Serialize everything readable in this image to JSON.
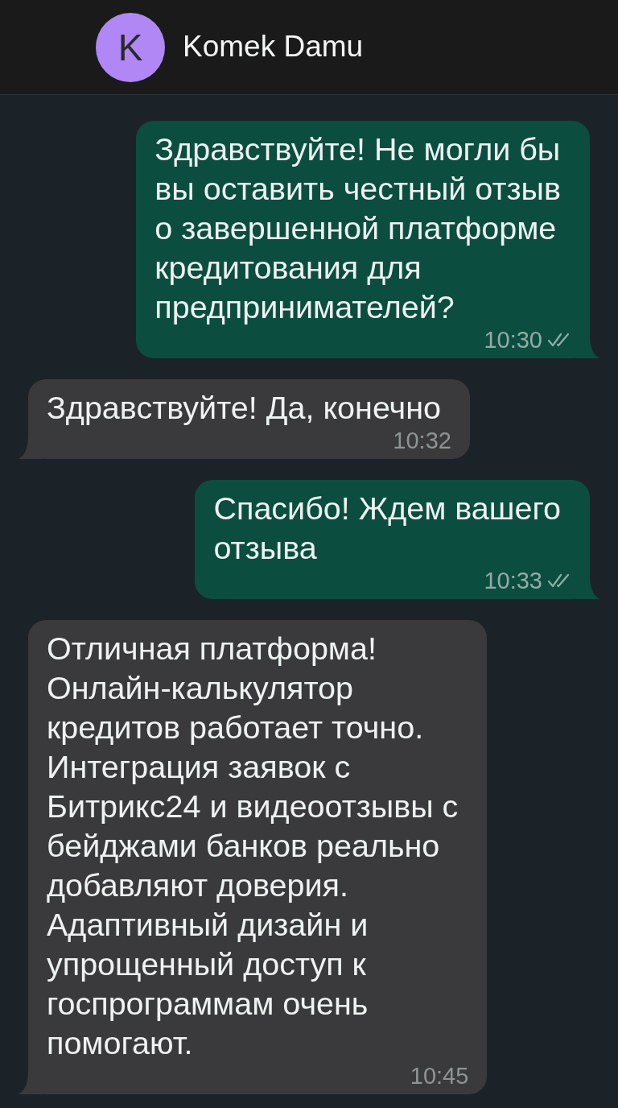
{
  "header": {
    "avatar_letter": "K",
    "name": "Komek Damu"
  },
  "messages": [
    {
      "kind": "outgoing",
      "text": "Здравствуйте! Не могли бы\nвы оставить честный отзыв\nо завершенной платформе\nкредитования для\nпредпринимателей?",
      "time": "10:30",
      "read": true
    },
    {
      "kind": "incoming",
      "text": "Здравствуйте! Да, конечно",
      "time": "10:32"
    },
    {
      "kind": "outgoing",
      "text": "Спасибо! Ждем вашего\nотзыва",
      "time": "10:33",
      "read": true
    },
    {
      "kind": "incoming",
      "text": "Отличная платформа!\nОнлайн-калькулятор\nкредитов работает точно.\nИнтеграция заявок с\nБитрикс24 и видеоотзывы с\nбейджами банков реально\nдобавляют доверия.\nАдаптивный дизайн и\nупрощенный доступ к\nгоспрограммам очень\nпомогают.",
      "time": "10:45"
    }
  ]
}
